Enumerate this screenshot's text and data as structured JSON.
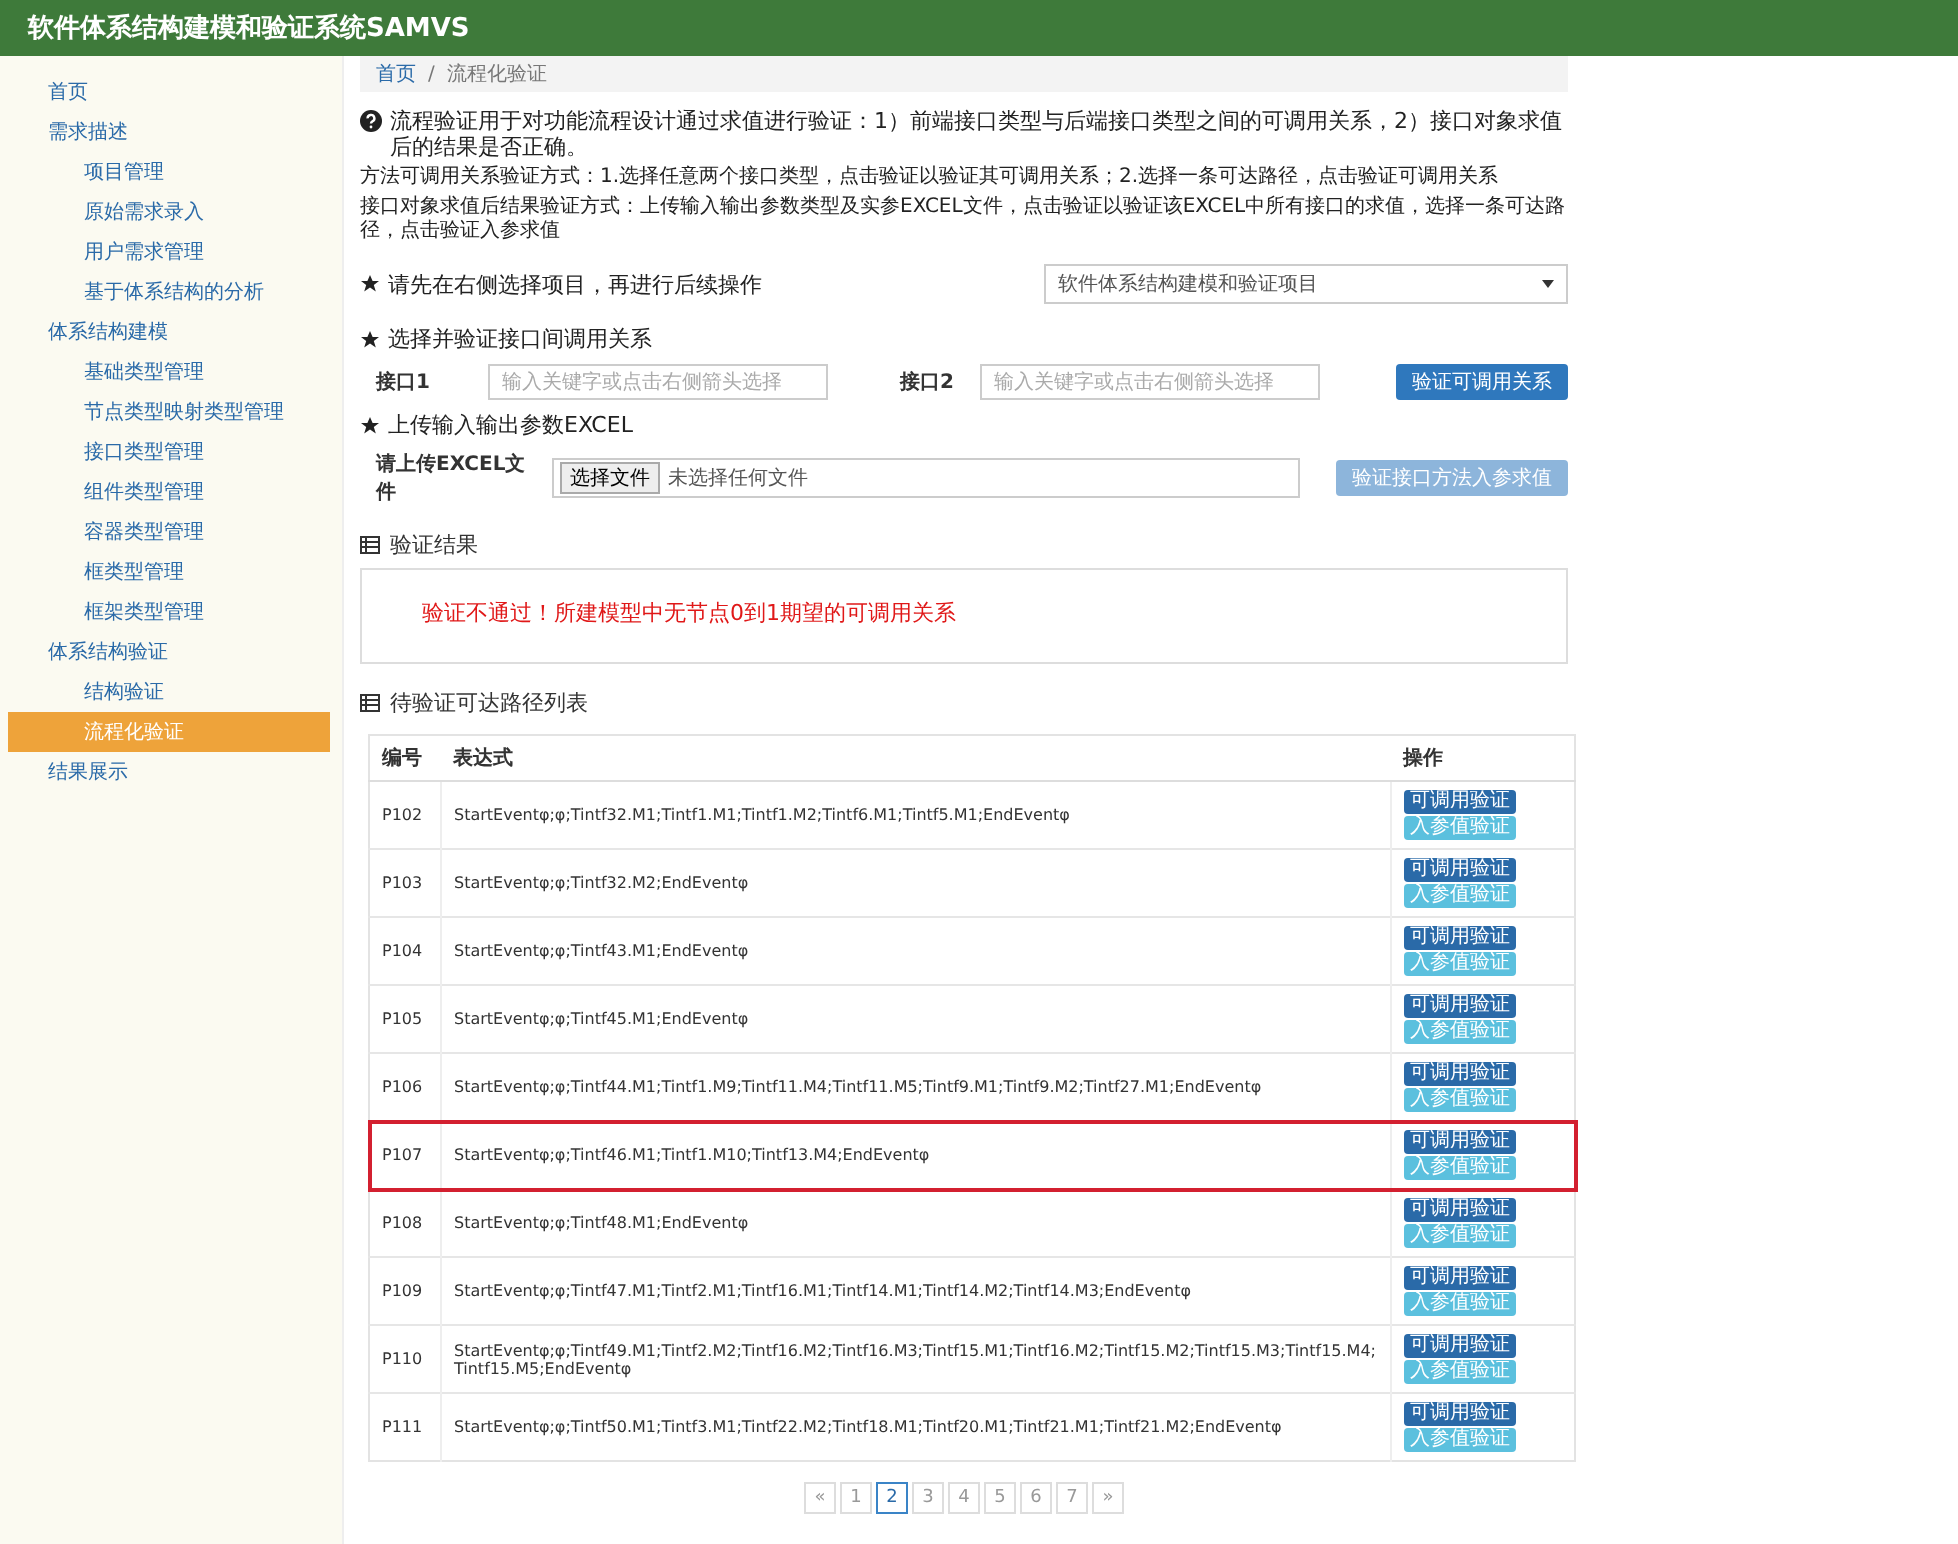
{
  "app_title": "软件体系结构建模和验证系统SAMVS",
  "sidebar": {
    "items": [
      {
        "label": "首页",
        "selected": false
      },
      {
        "label": "需求描述",
        "selected": false,
        "children": [
          {
            "label": "项目管理",
            "selected": false
          },
          {
            "label": "原始需求录入",
            "selected": false
          },
          {
            "label": "用户需求管理",
            "selected": false
          },
          {
            "label": "基于体系结构的分析",
            "selected": false
          }
        ]
      },
      {
        "label": "体系结构建模",
        "selected": false,
        "children": [
          {
            "label": "基础类型管理",
            "selected": false
          },
          {
            "label": "节点类型映射类型管理",
            "selected": false
          },
          {
            "label": "接口类型管理",
            "selected": false
          },
          {
            "label": "组件类型管理",
            "selected": false
          },
          {
            "label": "容器类型管理",
            "selected": false
          },
          {
            "label": "框类型管理",
            "selected": false
          },
          {
            "label": "框架类型管理",
            "selected": false
          }
        ]
      },
      {
        "label": "体系结构验证",
        "selected": false,
        "children": [
          {
            "label": "结构验证",
            "selected": false
          },
          {
            "label": "流程化验证",
            "selected": true
          }
        ]
      },
      {
        "label": "结果展示",
        "selected": false
      }
    ]
  },
  "breadcrumb": {
    "home": "首页",
    "separator": "/",
    "current": "流程化验证"
  },
  "intro": "流程验证用于对功能流程设计通过求值进行验证：1）前端接口类型与后端接口类型之间的可调用关系，2）接口对象求值后的结果是否正确。",
  "notes": [
    "方法可调用关系验证方式：1.选择任意两个接口类型，点击验证以验证其可调用关系；2.选择一条可达路径，点击验证可调用关系",
    "接口对象求值后结果验证方式：上传输入输出参数类型及实参EXCEL文件，点击验证以验证该EXCEL中所有接口的求值，选择一条可达路径，点击验证入参求值"
  ],
  "project_step": {
    "label": "请先在右侧选择项目，再进行后续操作",
    "select_value": "软件体系结构建模和验证项目"
  },
  "interface_step": {
    "label": "选择并验证接口间调用关系",
    "field1_label": "接口1",
    "field1_placeholder": "输入关键字或点击右侧箭头选择",
    "field2_label": "接口2",
    "field2_placeholder": "输入关键字或点击右侧箭头选择",
    "button": "验证可调用关系"
  },
  "excel_step": {
    "label": "上传输入输出参数EXCEL",
    "field_label": "请上传EXCEL文件",
    "file_button": "选择文件",
    "file_status": "未选择任何文件",
    "button": {
      "label": "验证接口方法入参求值",
      "disabled": true
    }
  },
  "result": {
    "title": "验证结果",
    "message": "验证不通过！所建模型中无节点0到1期望的可调用关系"
  },
  "paths": {
    "title": "待验证可达路径列表",
    "columns": [
      "编号",
      "表达式",
      "操作"
    ],
    "rows": [
      {
        "id": "P102",
        "expr": "StartEventφ;φ;Tintf32.M1;Tintf1.M1;Tintf1.M2;Tintf6.M1;Tintf5.M1;EndEventφ",
        "highlighted": false,
        "actions": [
          "可调用验证",
          "入参值验证"
        ]
      },
      {
        "id": "P103",
        "expr": "StartEventφ;φ;Tintf32.M2;EndEventφ",
        "highlighted": false,
        "actions": [
          "可调用验证",
          "入参值验证"
        ]
      },
      {
        "id": "P104",
        "expr": "StartEventφ;φ;Tintf43.M1;EndEventφ",
        "highlighted": false,
        "actions": [
          "可调用验证",
          "入参值验证"
        ]
      },
      {
        "id": "P105",
        "expr": "StartEventφ;φ;Tintf45.M1;EndEventφ",
        "highlighted": false,
        "actions": [
          "可调用验证",
          "入参值验证"
        ]
      },
      {
        "id": "P106",
        "expr": "StartEventφ;φ;Tintf44.M1;Tintf1.M9;Tintf11.M4;Tintf11.M5;Tintf9.M1;Tintf9.M2;Tintf27.M1;EndEventφ",
        "highlighted": false,
        "actions": [
          "可调用验证",
          "入参值验证"
        ]
      },
      {
        "id": "P107",
        "expr": "StartEventφ;φ;Tintf46.M1;Tintf1.M10;Tintf13.M4;EndEventφ",
        "highlighted": true,
        "actions": [
          "可调用验证",
          "入参值验证"
        ]
      },
      {
        "id": "P108",
        "expr": "StartEventφ;φ;Tintf48.M1;EndEventφ",
        "highlighted": false,
        "actions": [
          "可调用验证",
          "入参值验证"
        ]
      },
      {
        "id": "P109",
        "expr": "StartEventφ;φ;Tintf47.M1;Tintf2.M1;Tintf16.M1;Tintf14.M1;Tintf14.M2;Tintf14.M3;EndEventφ",
        "highlighted": false,
        "actions": [
          "可调用验证",
          "入参值验证"
        ]
      },
      {
        "id": "P110",
        "expr": "StartEventφ;φ;Tintf49.M1;Tintf2.M2;Tintf16.M2;Tintf16.M3;Tintf15.M1;Tintf16.M2;Tintf15.M2;Tintf15.M3;Tintf15.M4;Tintf15.M5;EndEventφ",
        "highlighted": false,
        "actions": [
          "可调用验证",
          "入参值验证"
        ]
      },
      {
        "id": "P111",
        "expr": "StartEventφ;φ;Tintf50.M1;Tintf3.M1;Tintf22.M2;Tintf18.M1;Tintf20.M1;Tintf21.M1;Tintf21.M2;EndEventφ",
        "highlighted": false,
        "actions": [
          "可调用验证",
          "入参值验证"
        ]
      }
    ]
  },
  "pagination": [
    {
      "label": "«",
      "selected": false
    },
    {
      "label": "1",
      "selected": false
    },
    {
      "label": "2",
      "selected": true
    },
    {
      "label": "3",
      "selected": false
    },
    {
      "label": "4",
      "selected": false
    },
    {
      "label": "5",
      "selected": false
    },
    {
      "label": "6",
      "selected": false
    },
    {
      "label": "7",
      "selected": false
    },
    {
      "label": "»",
      "selected": false
    }
  ]
}
